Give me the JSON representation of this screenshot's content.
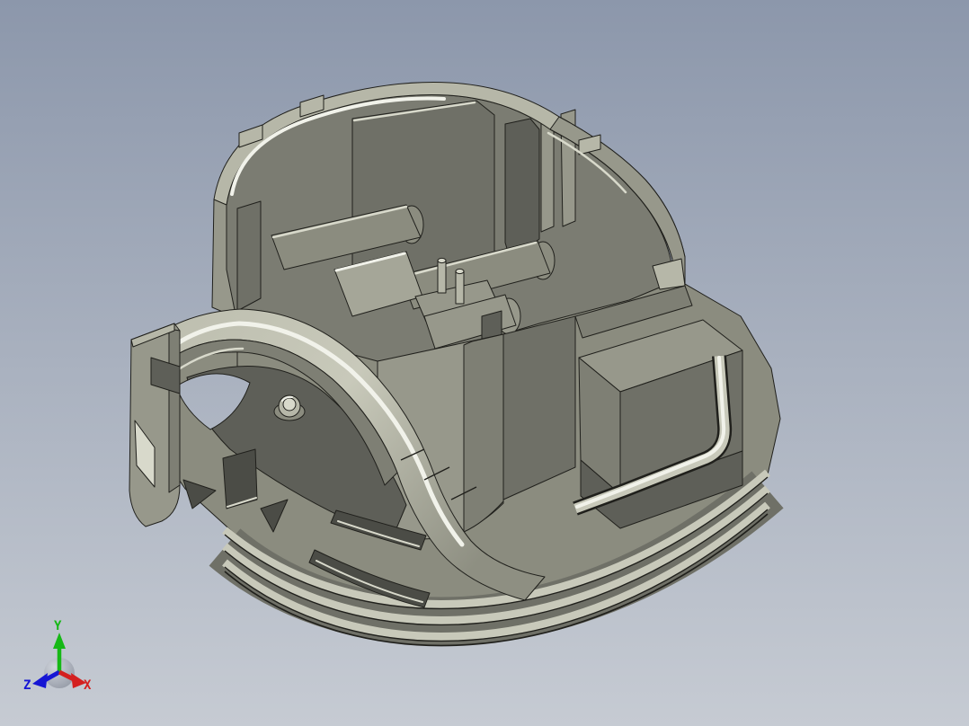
{
  "scene": {
    "description": "Isometric shaded 3D CAD view of an olive-gray injection-molded plastic housing: open-top connector box with internal rib walls and guide pins, a large curved hook arm on the left, a rectangular pocket block with wrap-around rounded rail on the right, and a stepped oval base with stacked flange rails and triangular lightening cutouts",
    "render_style": "shaded-with-edges"
  },
  "triad": {
    "x_label": "X",
    "y_label": "Y",
    "z_label": "Z"
  },
  "colors": {
    "bg_top": "#8c97ab",
    "bg_bottom": "#c6cbd3",
    "line": "#20201c",
    "light": "#b6b7a8",
    "mid": "#97988b",
    "mid2": "#8b8c7f",
    "midshade": "#7e7f74",
    "dark": "#6f7067",
    "darker": "#5e5f58",
    "cavity": "#7b7c72",
    "hole": "#4b4c46",
    "floor": "#a5a698",
    "steel": "#c8c9ba",
    "hi": "#f1f2ea",
    "hi2": "#d8d9cb",
    "arm_light": "#bcbdae",
    "arm_dark": "#8e8f82",
    "sphere_light": "#d3d7de",
    "sphere_dark": "#848a97",
    "axis_x": "#d42020",
    "axis_y": "#16b816",
    "axis_z": "#1616d4"
  }
}
